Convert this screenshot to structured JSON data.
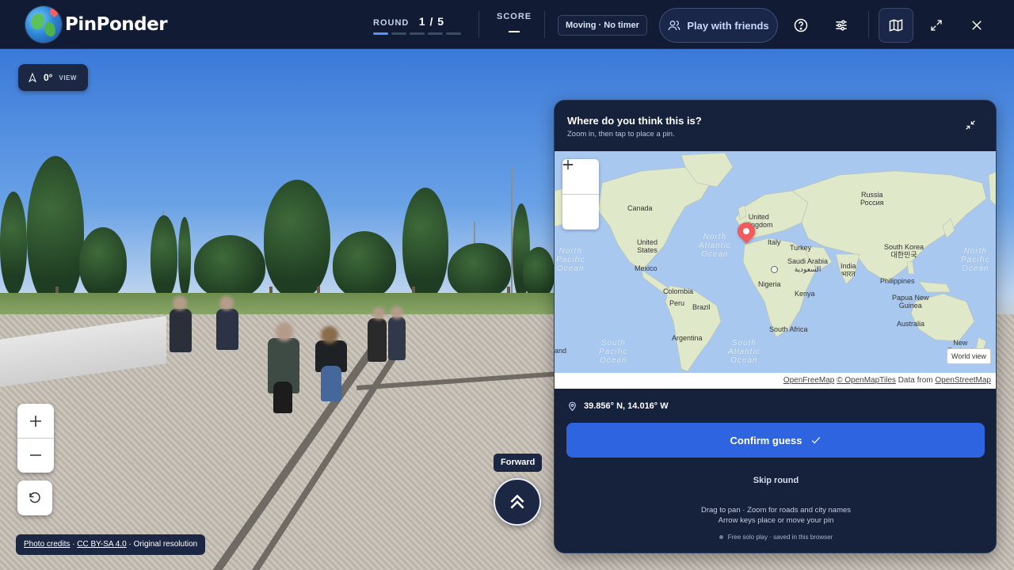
{
  "app": {
    "name": "PinPonder"
  },
  "header": {
    "round_label": "ROUND",
    "round_value": "1 / 5",
    "round_total": 5,
    "round_current": 1,
    "score_label": "SCORE",
    "mode": "Moving · No timer",
    "play_with_friends": "Play with friends"
  },
  "view": {
    "heading": "0°",
    "label": "VIEW"
  },
  "street": {
    "forward_tooltip": "Forward",
    "credits_link": "Photo credits",
    "license": "CC BY-SA 4.0",
    "resolution": "Original resolution"
  },
  "panel": {
    "title": "Where do you think this is?",
    "subtitle": "Zoom in, then tap to place a pin.",
    "coords": "39.856° N, 14.016° W",
    "confirm_label": "Confirm guess",
    "skip_label": "Skip round",
    "hint_line1": "Drag to pan · Zoom for roads and city names",
    "hint_line2": "Arrow keys place or move your pin",
    "save_note": "Free solo play · saved in this browser"
  },
  "map": {
    "world_view": "World view",
    "attribution": {
      "openfreemap": "OpenFreeMap",
      "openmaptiles": "© OpenMapTiles",
      "data_from": "Data from",
      "openstreetmap": "OpenStreetMap"
    },
    "labels": {
      "canada": "Canada",
      "united_states": "United\nStates",
      "mexico": "Mexico",
      "colombia": "Colombia",
      "peru": "Peru",
      "brazil": "Brazil",
      "argentina": "Argentina",
      "united_kingdom": "United\nKingdom",
      "italy": "Italy",
      "turkey": "Turkey",
      "saudi_arabia": "Saudi Arabia\nالسعودية",
      "india": "India\nभारत",
      "russia": "Russia\nРоссия",
      "south_korea": "South Korea\n대한민국",
      "philippines": "Philippines",
      "papua_new_guinea": "Papua New\nGuinea",
      "australia": "Australia",
      "nigeria": "Nigeria",
      "kenya": "Kenya",
      "south_africa": "South Africa",
      "new_zealand": "New\nZealand"
    },
    "oceans": {
      "north_pacific_left": "North\nPacific\nOcean",
      "north_atlantic": "North\nAtlantic\nOcean",
      "north_pacific_right": "North\nPacific\nOcean",
      "south_pacific": "South\nPacific\nOcean",
      "south_atlantic": "South\nAtlantic\nOcean",
      "partial_and": "and"
    }
  },
  "colors": {
    "topbar": "#111b33",
    "panel": "#16213c",
    "accent": "#2f64e0",
    "pin": "#f25b5b",
    "map_water": "#a8c8f0",
    "map_land": "#dfe8c9"
  },
  "icons": {
    "friends": "users-icon",
    "help": "question-circle-icon",
    "settings": "sliders-icon",
    "map": "map-icon",
    "fullscreen": "expand-icon",
    "close": "close-icon",
    "compass": "navigation-arrow-icon",
    "reset": "rotate-ccw-icon",
    "forward": "double-chevron-up-icon",
    "collapse": "minimize-icon",
    "location": "map-pin-icon",
    "check": "check-icon"
  }
}
